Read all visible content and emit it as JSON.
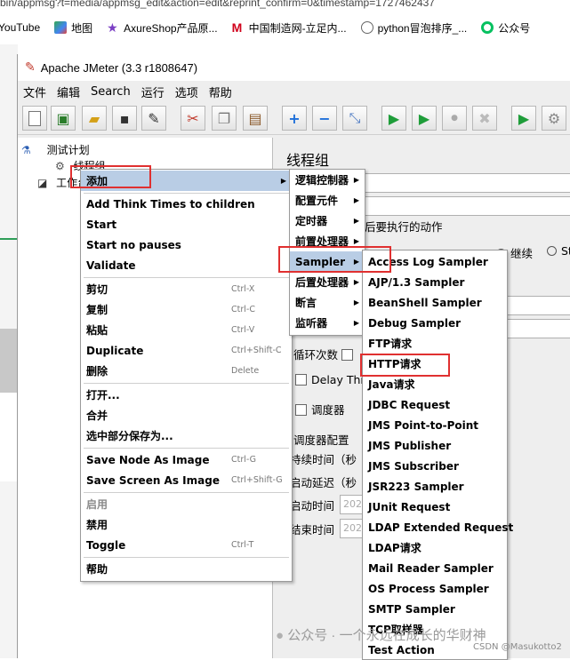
{
  "browser": {
    "url_fragment": "bin/appmsg?t=media/appmsg_edit&action=edit&reprint_confirm=0&timestamp=1727462437",
    "bookmarks": [
      "YouTube",
      "地图",
      "AxureShop产品原...",
      "中国制造网-立足内...",
      "python冒泡排序_...",
      "公众号"
    ]
  },
  "window": {
    "title": "Apache JMeter (3.3 r1808647)",
    "menus": [
      "文件",
      "编辑",
      "Search",
      "运行",
      "选项",
      "帮助"
    ]
  },
  "toolbar": {
    "icons": [
      "new-icon",
      "templates-icon",
      "open-icon",
      "save-icon",
      "save-as-icon",
      "cut-icon",
      "copy-icon",
      "paste-icon",
      "expand-icon",
      "collapse-icon",
      "toggle-icon",
      "start-icon",
      "start-no-pauses-icon",
      "stop-icon",
      "shutdown-icon",
      "remote-start-icon",
      "remote-icon"
    ]
  },
  "tree": {
    "root": "测试计划",
    "thread_group": "线程组",
    "workbench": "工作台"
  },
  "panel": {
    "title": "线程组",
    "action_label": "后要执行的动作",
    "continue_label": "继续",
    "st_label": "St",
    "loop_label": "循环次数",
    "delay_label": "Delay Thre",
    "scheduler_label": "调度器",
    "scheduler_config": "调度器配置",
    "duration_label": "持续时间（秒",
    "startup_delay_label": "启动延迟（秒",
    "start_time_label": "启动时间",
    "end_time_label": "结束时间",
    "start_time_value": "202",
    "end_time_value": "202"
  },
  "context_menu": {
    "add": "添加",
    "items1": [
      "Add Think Times to children",
      "Start",
      "Start no pauses",
      "Validate"
    ],
    "items2": [
      {
        "label": "剪切",
        "shortcut": "Ctrl-X"
      },
      {
        "label": "复制",
        "shortcut": "Ctrl-C"
      },
      {
        "label": "粘贴",
        "shortcut": "Ctrl-V"
      },
      {
        "label": "Duplicate",
        "shortcut": "Ctrl+Shift-C"
      },
      {
        "label": "删除",
        "shortcut": "Delete"
      }
    ],
    "items3": [
      "打开...",
      "合并",
      "选中部分保存为..."
    ],
    "items4": [
      {
        "label": "Save Node As Image",
        "shortcut": "Ctrl-G"
      },
      {
        "label": "Save Screen As Image",
        "shortcut": "Ctrl+Shift-G"
      }
    ],
    "enable": "启用",
    "disable": "禁用",
    "toggle": "Toggle",
    "toggle_shortcut": "Ctrl-T",
    "help": "帮助"
  },
  "add_submenu": [
    "逻辑控制器",
    "配置元件",
    "定时器",
    "前置处理器",
    "Sampler",
    "后置处理器",
    "断言",
    "监听器"
  ],
  "sampler_submenu": [
    "Access Log Sampler",
    "AJP/1.3 Sampler",
    "BeanShell Sampler",
    "Debug Sampler",
    "FTP请求",
    "HTTP请求",
    "Java请求",
    "JDBC Request",
    "JMS Point-to-Point",
    "JMS Publisher",
    "JMS Subscriber",
    "JSR223 Sampler",
    "JUnit Request",
    "LDAP Extended Request",
    "LDAP请求",
    "Mail Reader Sampler",
    "OS Process Sampler",
    "SMTP Sampler",
    "TCP取样器",
    "Test Action"
  ],
  "watermark": "公众号 · 一个永远在成长的华财神",
  "csdn": "CSDN @Masukotto2",
  "colors": {
    "highlight": "#b9cde5",
    "annotation": "#e03030"
  }
}
